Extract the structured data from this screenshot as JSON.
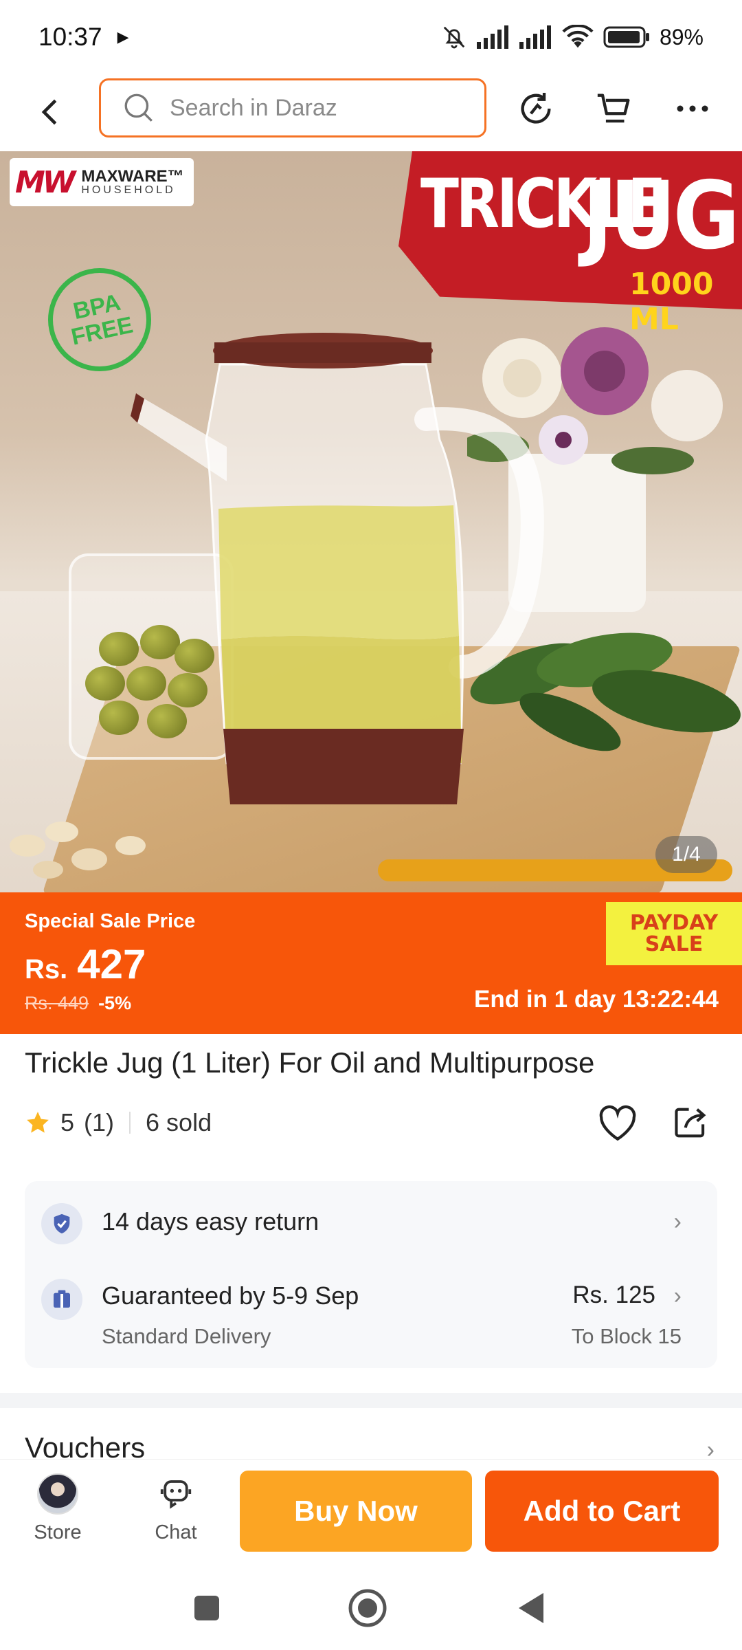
{
  "status_bar": {
    "time": "10:37",
    "battery": "89%"
  },
  "search": {
    "placeholder": "Search in Daraz"
  },
  "hero": {
    "brand_name": "MAXWARE™",
    "brand_sub": "HOUSEHOLD",
    "headline_1": "TRICKLE",
    "headline_2": "JUG",
    "capacity": "1000 ML",
    "badge_line_1": "BPA",
    "badge_line_2": "FREE",
    "counter": "1/4"
  },
  "price": {
    "label": "Special Sale Price",
    "currency": "Rs.",
    "value": "427",
    "original": "Rs. 449",
    "discount": "-5%",
    "campaign_line_1": "PAYDAY",
    "campaign_line_2": "SALE",
    "countdown": "End in 1 day 13:22:44"
  },
  "product": {
    "title": "Trickle Jug (1 Liter) For Oil and Multipurpose",
    "rating": "5",
    "rating_count": "(1)",
    "sold": "6 sold"
  },
  "delivery": {
    "return_text": "14 days easy return",
    "guarantee_text": "Guaranteed by 5-9 Sep",
    "method": "Standard Delivery",
    "fee": "Rs. 125",
    "destination": "To Block 15"
  },
  "vouchers": {
    "title": "Vouchers"
  },
  "bottom_bar": {
    "store_label": "Store",
    "chat_label": "Chat",
    "buy_now_label": "Buy Now",
    "add_to_cart_label": "Add to Cart"
  },
  "colors": {
    "accent": "#f7560a",
    "buy_now": "#fca523",
    "payday_bg": "#f3f13f",
    "star": "#fbb521"
  }
}
